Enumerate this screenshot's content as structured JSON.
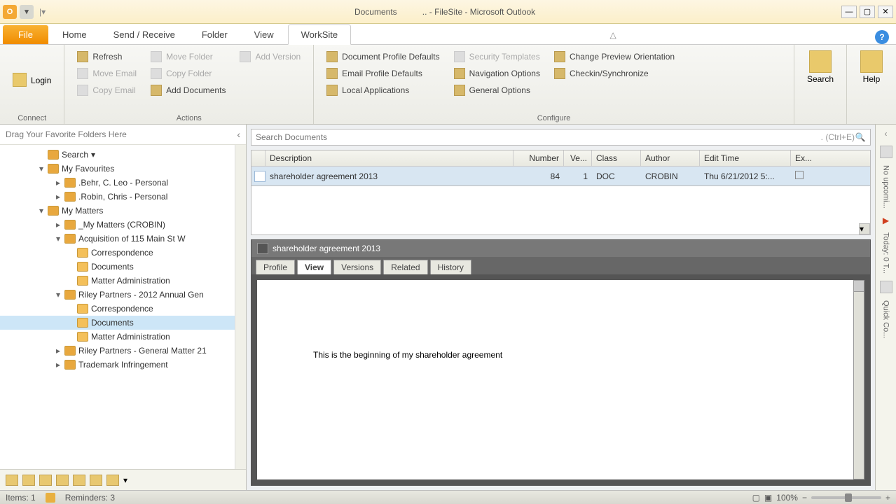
{
  "titlebar": {
    "doc_label": "Documents",
    "app_title": ".. - FileSite - Microsoft Outlook"
  },
  "tabs": {
    "file": "File",
    "items": [
      "Home",
      "Send / Receive",
      "Folder",
      "View",
      "WorkSite"
    ],
    "active": "WorkSite"
  },
  "ribbon": {
    "connect": {
      "login": "Login",
      "label": "Connect"
    },
    "actions": {
      "refresh": "Refresh",
      "move_email": "Move Email",
      "copy_email": "Copy Email",
      "move_folder": "Move Folder",
      "copy_folder": "Copy Folder",
      "add_documents": "Add Documents",
      "add_version": "Add Version",
      "label": "Actions"
    },
    "configure": {
      "doc_profile": "Document Profile Defaults",
      "email_profile": "Email Profile Defaults",
      "local_apps": "Local Applications",
      "security": "Security Templates",
      "navigation": "Navigation Options",
      "general": "General Options",
      "change_preview": "Change Preview Orientation",
      "checkin": "Checkin/Synchronize",
      "label": "Configure"
    },
    "search": "Search",
    "help": "Help"
  },
  "left": {
    "fav_hint": "Drag Your Favorite Folders Here",
    "tree": {
      "search": "Search",
      "my_favourites": "My Favourites",
      "behr": ".Behr, C. Leo - Personal",
      "robin": ".Robin, Chris - Personal",
      "my_matters": "My Matters",
      "my_matters_crobin": "_My Matters (CROBIN)",
      "acquisition": "Acquisition of 115 Main St W",
      "correspondence": "Correspondence",
      "documents": "Documents",
      "matter_admin": "Matter Administration",
      "riley_2012": "Riley Partners - 2012 Annual Gen",
      "riley_general": "Riley Partners - General Matter 21",
      "trademark": "Trademark Infringement"
    }
  },
  "search": {
    "placeholder": "Search Documents",
    "hint": ". (Ctrl+E)"
  },
  "table": {
    "headers": {
      "description": "Description",
      "number": "Number",
      "ver": "Ve...",
      "class": "Class",
      "author": "Author",
      "edit_time": "Edit Time",
      "ex": "Ex..."
    },
    "rows": [
      {
        "description": "shareholder agreement 2013",
        "number": "84",
        "ver": "1",
        "class": "DOC",
        "author": "CROBIN",
        "edit_time": "Thu 6/21/2012 5:..."
      }
    ]
  },
  "preview": {
    "title": "shareholder agreement 2013",
    "tabs": [
      "Profile",
      "View",
      "Versions",
      "Related",
      "History"
    ],
    "active_tab": "View",
    "body": "This is the beginning of my shareholder agreement"
  },
  "right_rail": {
    "upcoming": "No upcomi...",
    "today": "Today: 0 T...",
    "quick": "Quick Co..."
  },
  "status": {
    "items": "Items: 1",
    "reminders": "Reminders: 3",
    "zoom": "100%"
  }
}
